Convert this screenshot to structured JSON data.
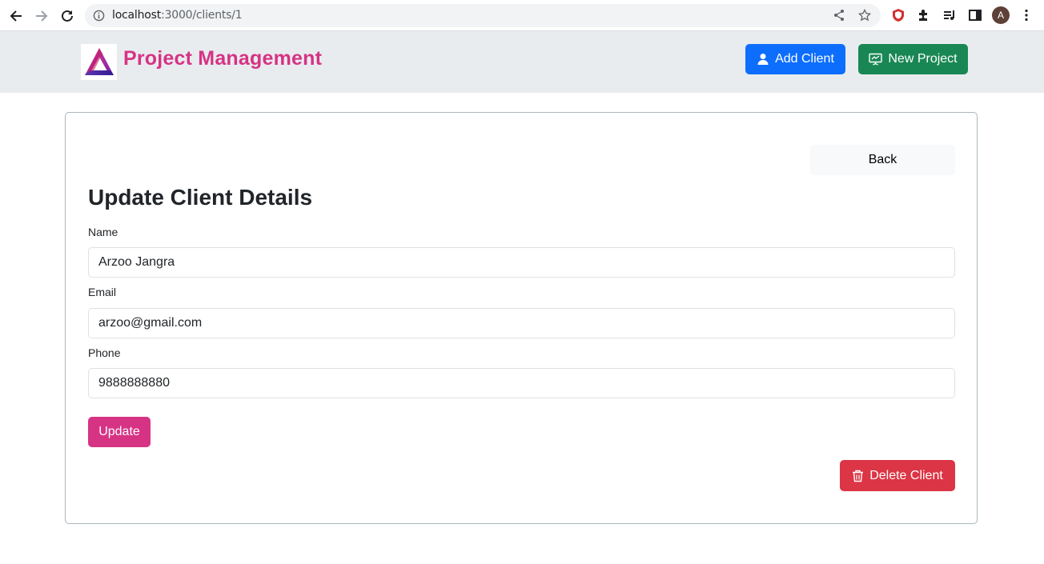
{
  "browser": {
    "url_host": "localhost",
    "url_path": ":3000/clients/1",
    "profile_initial": "A",
    "icons": [
      "back-arrow-icon",
      "forward-arrow-icon",
      "reload-icon",
      "info-icon",
      "share-icon",
      "star-icon",
      "shield-extension-icon",
      "puzzle-icon",
      "reading-list-icon",
      "side-panel-icon",
      "kebab-menu-icon"
    ]
  },
  "navbar": {
    "brand": "Project Management",
    "add_client_label": "Add Client",
    "new_project_label": "New Project"
  },
  "card": {
    "back_label": "Back",
    "title": "Update Client Details",
    "fields": [
      {
        "label": "Name",
        "value": "Arzoo Jangra"
      },
      {
        "label": "Email",
        "value": "arzoo@gmail.com"
      },
      {
        "label": "Phone",
        "value": "9888888880"
      }
    ],
    "update_label": "Update",
    "delete_label": "Delete Client"
  },
  "colors": {
    "brand_pink": "#d63384",
    "primary_blue": "#0d6efd",
    "success_green": "#198754",
    "danger_red": "#dc3545",
    "navbar_bg": "#e9ecef"
  }
}
